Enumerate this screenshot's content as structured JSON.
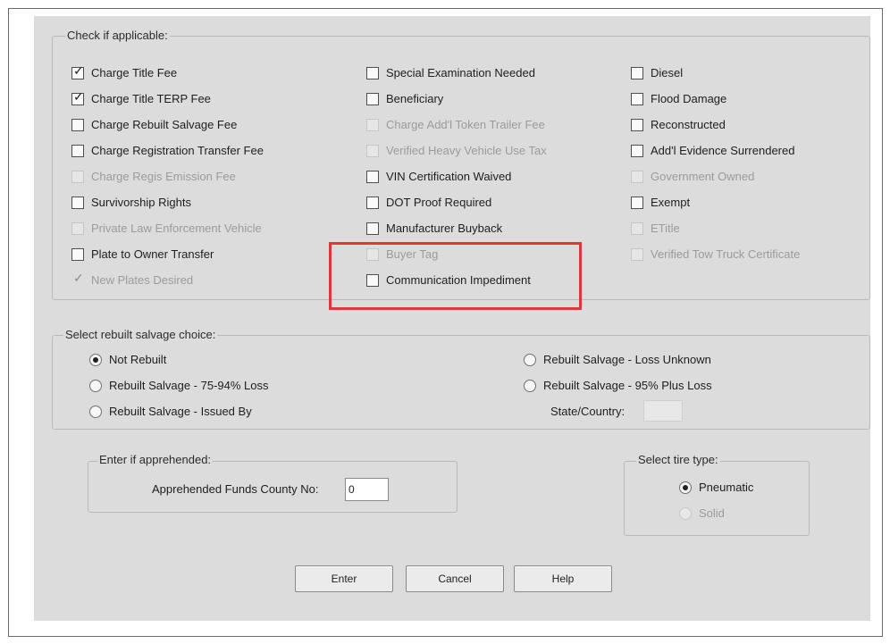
{
  "applicable": {
    "title": "Check if applicable:",
    "col1": [
      {
        "label": "Charge Title Fee",
        "checked": true,
        "disabled": false
      },
      {
        "label": "Charge Title TERP Fee",
        "checked": true,
        "disabled": false
      },
      {
        "label": "Charge Rebuilt Salvage Fee",
        "checked": false,
        "disabled": false
      },
      {
        "label": "Charge Registration Transfer Fee",
        "checked": false,
        "disabled": false
      },
      {
        "label": "Charge Regis Emission Fee",
        "checked": false,
        "disabled": true
      },
      {
        "label": "Survivorship Rights",
        "checked": false,
        "disabled": false
      },
      {
        "label": "Private Law Enforcement Vehicle",
        "checked": false,
        "disabled": true
      },
      {
        "label": "Plate to Owner Transfer",
        "checked": false,
        "disabled": false
      },
      {
        "label": "New Plates Desired",
        "checked": true,
        "disabled": true
      }
    ],
    "col2": [
      {
        "label": "Special Examination Needed",
        "checked": false,
        "disabled": false
      },
      {
        "label": "Beneficiary",
        "checked": false,
        "disabled": false
      },
      {
        "label": "Charge Add'l Token Trailer Fee",
        "checked": false,
        "disabled": true
      },
      {
        "label": "Verified Heavy Vehicle Use Tax",
        "checked": false,
        "disabled": true
      },
      {
        "label": "VIN Certification Waived",
        "checked": false,
        "disabled": false
      },
      {
        "label": "DOT Proof Required",
        "checked": false,
        "disabled": false
      },
      {
        "label": "Manufacturer Buyback",
        "checked": false,
        "disabled": false
      },
      {
        "label": "Buyer Tag",
        "checked": false,
        "disabled": true
      },
      {
        "label": "Communication Impediment",
        "checked": false,
        "disabled": false
      }
    ],
    "col3": [
      {
        "label": "Diesel",
        "checked": false,
        "disabled": false
      },
      {
        "label": "Flood Damage",
        "checked": false,
        "disabled": false
      },
      {
        "label": "Reconstructed",
        "checked": false,
        "disabled": false
      },
      {
        "label": "Add'l Evidence Surrendered",
        "checked": false,
        "disabled": false
      },
      {
        "label": "Government Owned",
        "checked": false,
        "disabled": true
      },
      {
        "label": "Exempt",
        "checked": false,
        "disabled": false
      },
      {
        "label": "ETitle",
        "checked": false,
        "disabled": true
      },
      {
        "label": "Verified Tow Truck Certificate",
        "checked": false,
        "disabled": true
      }
    ]
  },
  "salvage": {
    "title": "Select rebuilt salvage choice:",
    "left": [
      {
        "label": "Not Rebuilt",
        "selected": true
      },
      {
        "label": "Rebuilt Salvage - 75-94% Loss",
        "selected": false
      },
      {
        "label": "Rebuilt Salvage - Issued By",
        "selected": false
      }
    ],
    "right": [
      {
        "label": "Rebuilt Salvage - Loss Unknown",
        "selected": false
      },
      {
        "label": "Rebuilt Salvage - 95% Plus Loss",
        "selected": false
      }
    ],
    "state_label": "State/Country:",
    "state_value": ""
  },
  "apprehended": {
    "title": "Enter if apprehended:",
    "label": "Apprehended Funds County No:",
    "value": "0"
  },
  "tire": {
    "title": "Select tire type:",
    "options": [
      {
        "label": "Pneumatic",
        "selected": true,
        "disabled": false
      },
      {
        "label": "Solid",
        "selected": false,
        "disabled": true
      }
    ]
  },
  "buttons": {
    "enter": "Enter",
    "cancel": "Cancel",
    "help": "Help"
  }
}
